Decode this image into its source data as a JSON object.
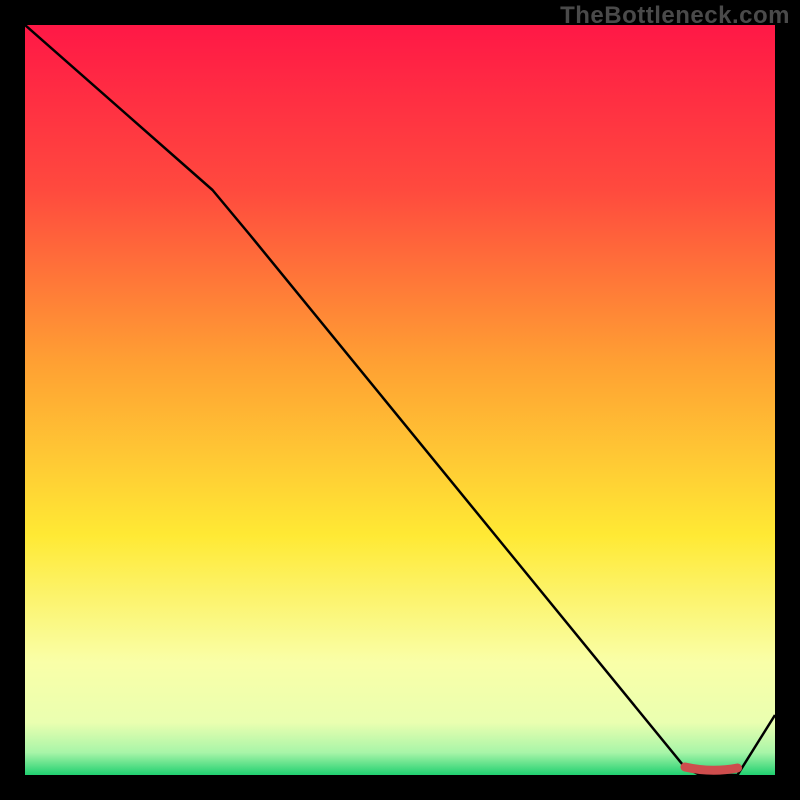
{
  "watermark": "TheBottleneck.com",
  "colors": {
    "background": "#000000",
    "line_black": "#000000",
    "marker_red": "#ce4d4d",
    "gradient_top": "#ff1846",
    "gradient_mid_red": "#ff5a3a",
    "gradient_orange": "#ffa033",
    "gradient_yellow": "#ffe934",
    "gradient_pale": "#f9ffa8",
    "gradient_green": "#20d070"
  },
  "chart_data": {
    "type": "line",
    "title": "",
    "xlabel": "",
    "ylabel": "",
    "x": [
      0,
      25,
      30,
      88,
      90,
      95,
      100
    ],
    "values": [
      100,
      78,
      72,
      1,
      0,
      0,
      8
    ],
    "xlim": [
      0,
      100
    ],
    "ylim": [
      0,
      100
    ],
    "markers": {
      "x_range": [
        88,
        95
      ],
      "y": 0
    }
  }
}
